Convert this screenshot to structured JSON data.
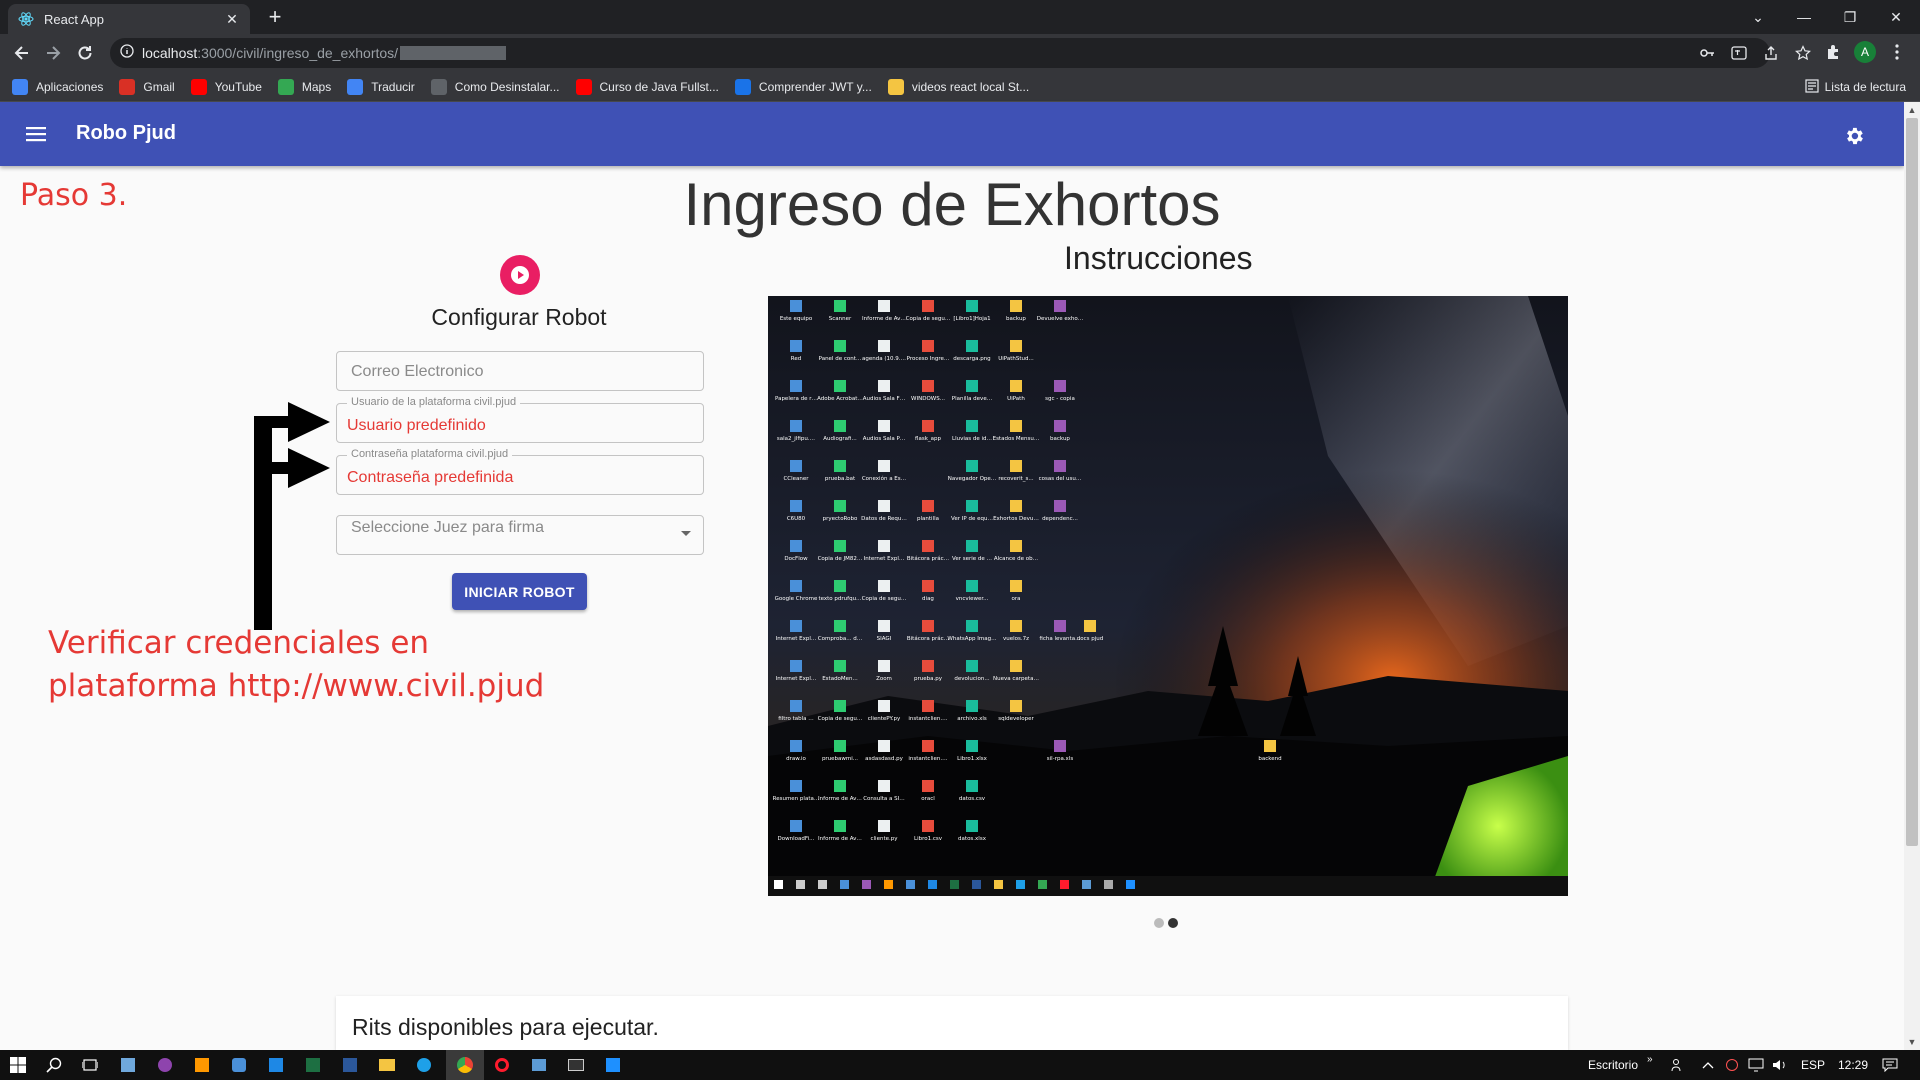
{
  "browser": {
    "tab_title": "React App",
    "url_host": "localhost",
    "url_path": ":3000/civil/ingreso_de_exhortos/",
    "reading_list": "Lista de lectura",
    "profile_initial": "A",
    "bookmarks": [
      {
        "label": "Aplicaciones",
        "icon": "apps-grid-icon",
        "color": "#4285f4"
      },
      {
        "label": "Gmail",
        "icon": "gmail-icon",
        "color": "#d93025"
      },
      {
        "label": "YouTube",
        "icon": "youtube-icon",
        "color": "#ff0000"
      },
      {
        "label": "Maps",
        "icon": "maps-icon",
        "color": "#34a853"
      },
      {
        "label": "Traducir",
        "icon": "translate-icon",
        "color": "#4285f4"
      },
      {
        "label": "Como Desinstalar...",
        "icon": "site-icon",
        "color": "#5f6368"
      },
      {
        "label": "Curso de Java Fullst...",
        "icon": "youtube-icon",
        "color": "#ff0000"
      },
      {
        "label": "Comprender JWT y...",
        "icon": "site-b-icon",
        "color": "#1a73e8"
      },
      {
        "label": "videos react local St...",
        "icon": "folder-icon",
        "color": "#f4c542"
      }
    ]
  },
  "app": {
    "title": "Robo Pjud",
    "colors": {
      "primary": "#3f51b5",
      "accent": "#e91e63",
      "annotation": "#e53935"
    }
  },
  "page": {
    "step_label": "Paso 3.",
    "heading": "Ingreso de Exhortos",
    "instructions_heading": "Instrucciones",
    "config_title": "Configurar Robot",
    "email_placeholder": "Correo Electronico",
    "user_label": "Usuario de la plataforma civil.pjud",
    "user_value": "Usuario predefinido",
    "password_label": "Contraseña plataforma civil.pjud",
    "password_value": "Contraseña predefinida",
    "judge_placeholder": "Seleccione Juez para firma",
    "start_button": "INICIAR ROBOT",
    "annotation_line1": "Verificar credenciales en",
    "annotation_line2": "plataforma http://www.civil.pjud",
    "rits_title": "Rits disponibles para ejecutar.",
    "carousel_active_index": 2,
    "carousel_count": 2
  },
  "desktop_screenshot": {
    "icons": [
      "Este equipo",
      "Scanner",
      "Informe de Avance de ...",
      "Copia de seguridad d...",
      "[Libro1]Hoja1",
      "backup",
      "Devuelve exhorto",
      "Red",
      "Panel de control",
      "agenda (10.9.201.15...",
      "Proceso Ingreso Ex...",
      "descarga.png",
      "UiPathStud...",
      "",
      "Papelera de reciclaje",
      "Adobe Acrobat DC",
      "Audios Sala Familia",
      "WINDOWS...",
      "Planilla devengaci...",
      "UiPath",
      "sgc - copia",
      "sala2_jlfipu...",
      "Audiografi...",
      "Audios Sala Penal",
      "flask_app",
      "Lluvias de ideas",
      "Estados Mensuales",
      "backup",
      "CCleaner",
      "prueba.bat",
      "Conexión a Escritorio...",
      "",
      "Navegador Opera",
      "recoverit_s...",
      "cosas del usuario...",
      "C6U80",
      "pryectoRobo",
      "Datos de Requerimie...",
      "plantilla",
      "Ver IP de equipo.exe",
      "Exhortos Devueltos...",
      "dependenc...",
      "DocFlow",
      "Copia de JM8214_A...",
      "Internet Explorer",
      "Bitácora práctica pr...",
      "Ver serie de equipo.exe",
      "Alcance de objetivos Pr...",
      "",
      "Google Chrome",
      "texto pdrufquen...",
      "Copia de seguridad d...",
      "diag",
      "vncviewer...",
      "ora",
      "",
      "Internet Explorer (x64)",
      "Comproba... de Traspaso",
      "SIAGI",
      "Bitácora práctica pr...",
      "WhatsApp Image 2021...",
      "vuelos.7z",
      "ficha levantamie...",
      "Internet Explorer (x86)",
      "EstadoMen...",
      "Zoom",
      "prueba.py",
      "devolucion...",
      "Nueva carpeta (2)",
      "",
      "filtro tabla bandeja fun...",
      "Copia de seguridad d...",
      "clientePY.py",
      "instantclien...",
      "archivo.xls",
      "sqldeveloper",
      "",
      "draw.io",
      "pruebawmi...",
      "asdasdasd.py",
      "instantclien...",
      "Libro1.xlsx",
      "",
      "sil-rpa.xls",
      "Resumen platafor...",
      "Informe de Avance de ...",
      "Consulta a SII.xls",
      "oracl",
      "datos.csv",
      "",
      "",
      "DownloadFi...",
      "Informe de Avance de ...",
      "cliente.py",
      "Libro1.csv",
      "datos.xlsx",
      "",
      ""
    ],
    "extra_icons": [
      "docs pjud",
      "backend"
    ]
  },
  "taskbar": {
    "workspace": "Escritorio",
    "language": "ESP",
    "time": "12:29"
  }
}
